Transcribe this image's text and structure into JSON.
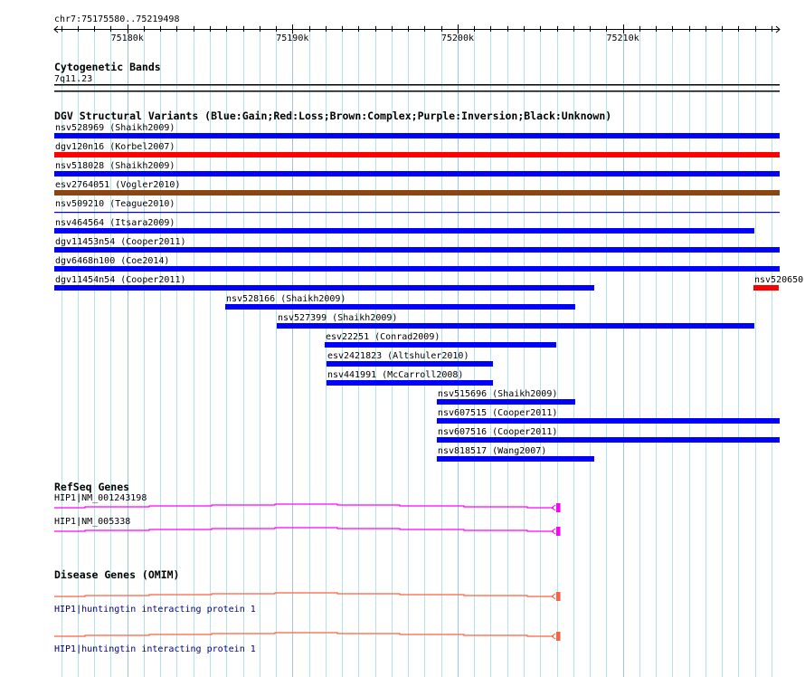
{
  "region": {
    "chrom": "chr7",
    "start": 75175580,
    "end": 75219498,
    "label": "chr7:75175580..75219498"
  },
  "ruler": {
    "tick_labels": [
      {
        "pos": 75180000,
        "label": "75180k"
      },
      {
        "pos": 75190000,
        "label": "75190k"
      },
      {
        "pos": 75200000,
        "label": "75200k"
      },
      {
        "pos": 75210000,
        "label": "75210k"
      }
    ]
  },
  "cytobands": {
    "title": "Cytogenetic Bands",
    "band": "7q11.23"
  },
  "dgv": {
    "title": "DGV Structural Variants (Blue:Gain;Red:Loss;Brown:Complex;Purple:Inversion;Black:Unknown)",
    "colors": {
      "gain": "#0000ff",
      "loss": "#ff0000",
      "complex": "#8b4513",
      "thin": "#0000cc"
    },
    "variants": [
      {
        "id": "nsv528969",
        "study": "Shaikh2009",
        "label": "nsv528969 (Shaikh2009)",
        "type": "gain",
        "start": 75175580,
        "end": 75219498,
        "row": 0
      },
      {
        "id": "dgv120n16",
        "study": "Korbel2007",
        "label": "dgv120n16 (Korbel2007)",
        "type": "loss",
        "start": 75175580,
        "end": 75219498,
        "row": 1
      },
      {
        "id": "nsv518028",
        "study": "Shaikh2009",
        "label": "nsv518028 (Shaikh2009)",
        "type": "gain",
        "start": 75175580,
        "end": 75219498,
        "row": 2
      },
      {
        "id": "esv2764051",
        "study": "Vogler2010",
        "label": "esv2764051 (Vogler2010)",
        "type": "complex",
        "start": 75175580,
        "end": 75219498,
        "row": 3
      },
      {
        "id": "nsv509210",
        "study": "Teague2010",
        "label": "nsv509210 (Teague2010)",
        "type": "thin",
        "start": 75175580,
        "end": 75219498,
        "row": 4
      },
      {
        "id": "nsv464564",
        "study": "Itsara2009",
        "label": "nsv464564 (Itsara2009)",
        "type": "gain",
        "start": 75175580,
        "end": 75217965,
        "row": 5
      },
      {
        "id": "dgv11453n54",
        "study": "Cooper2011",
        "label": "dgv11453n54 (Cooper2011)",
        "type": "gain",
        "start": 75175580,
        "end": 75219498,
        "row": 6
      },
      {
        "id": "dgv6468n100",
        "study": "Coe2014",
        "label": "dgv6468n100 (Coe2014)",
        "type": "gain",
        "start": 75175580,
        "end": 75219498,
        "row": 7
      },
      {
        "id": "dgv11454n54",
        "study": "Cooper2011",
        "label": "dgv11454n54 (Cooper2011)",
        "type": "gain",
        "start": 75175580,
        "end": 75208270,
        "row": 8
      },
      {
        "id": "nsv520650",
        "study": "",
        "label": "nsv520650",
        "type": "loss",
        "start": 75217910,
        "end": 75219440,
        "row": 8
      },
      {
        "id": "nsv528166",
        "study": "Shaikh2009",
        "label": "nsv528166 (Shaikh2009)",
        "type": "gain",
        "start": 75185930,
        "end": 75207120,
        "row": 9
      },
      {
        "id": "nsv527399",
        "study": "Shaikh2009",
        "label": "nsv527399 (Shaikh2009)",
        "type": "gain",
        "start": 75189050,
        "end": 75217965,
        "row": 10
      },
      {
        "id": "esv22251",
        "study": "Conrad2009",
        "label": "esv22251 (Conrad2009)",
        "type": "gain",
        "start": 75191950,
        "end": 75205970,
        "row": 11
      },
      {
        "id": "esv2421823",
        "study": "Altshuler2010",
        "label": "esv2421823 (Altshuler2010)",
        "type": "gain",
        "start": 75192060,
        "end": 75202140,
        "row": 12
      },
      {
        "id": "nsv441991",
        "study": "McCarroll2008",
        "label": "nsv441991 (McCarroll2008)",
        "type": "gain",
        "start": 75192060,
        "end": 75202140,
        "row": 13
      },
      {
        "id": "nsv515696",
        "study": "Shaikh2009",
        "label": "nsv515696 (Shaikh2009)",
        "type": "gain",
        "start": 75198740,
        "end": 75207120,
        "row": 14
      },
      {
        "id": "nsv607515",
        "study": "Cooper2011",
        "label": "nsv607515 (Cooper2011)",
        "type": "gain",
        "start": 75198740,
        "end": 75219498,
        "row": 15
      },
      {
        "id": "nsv607516",
        "study": "Cooper2011",
        "label": "nsv607516 (Cooper2011)",
        "type": "gain",
        "start": 75198740,
        "end": 75219498,
        "row": 16
      },
      {
        "id": "nsv818517",
        "study": "Wang2007",
        "label": "nsv818517 (Wang2007)",
        "type": "gain",
        "start": 75198740,
        "end": 75208270,
        "row": 17
      }
    ]
  },
  "refseq": {
    "title": "RefSeq Genes",
    "color": "#ff00ff",
    "genes": [
      {
        "label": "HIP1|NM_001243198",
        "strand": "-"
      },
      {
        "label": "HIP1|NM_005338",
        "strand": "-"
      }
    ]
  },
  "omim": {
    "title": "Disease Genes (OMIM)",
    "color": "#ff6040",
    "genes": [
      {
        "label": "HIP1|huntingtin interacting protein 1",
        "strand": "-"
      },
      {
        "label": "HIP1|huntingtin interacting protein 1",
        "strand": "-"
      }
    ]
  }
}
